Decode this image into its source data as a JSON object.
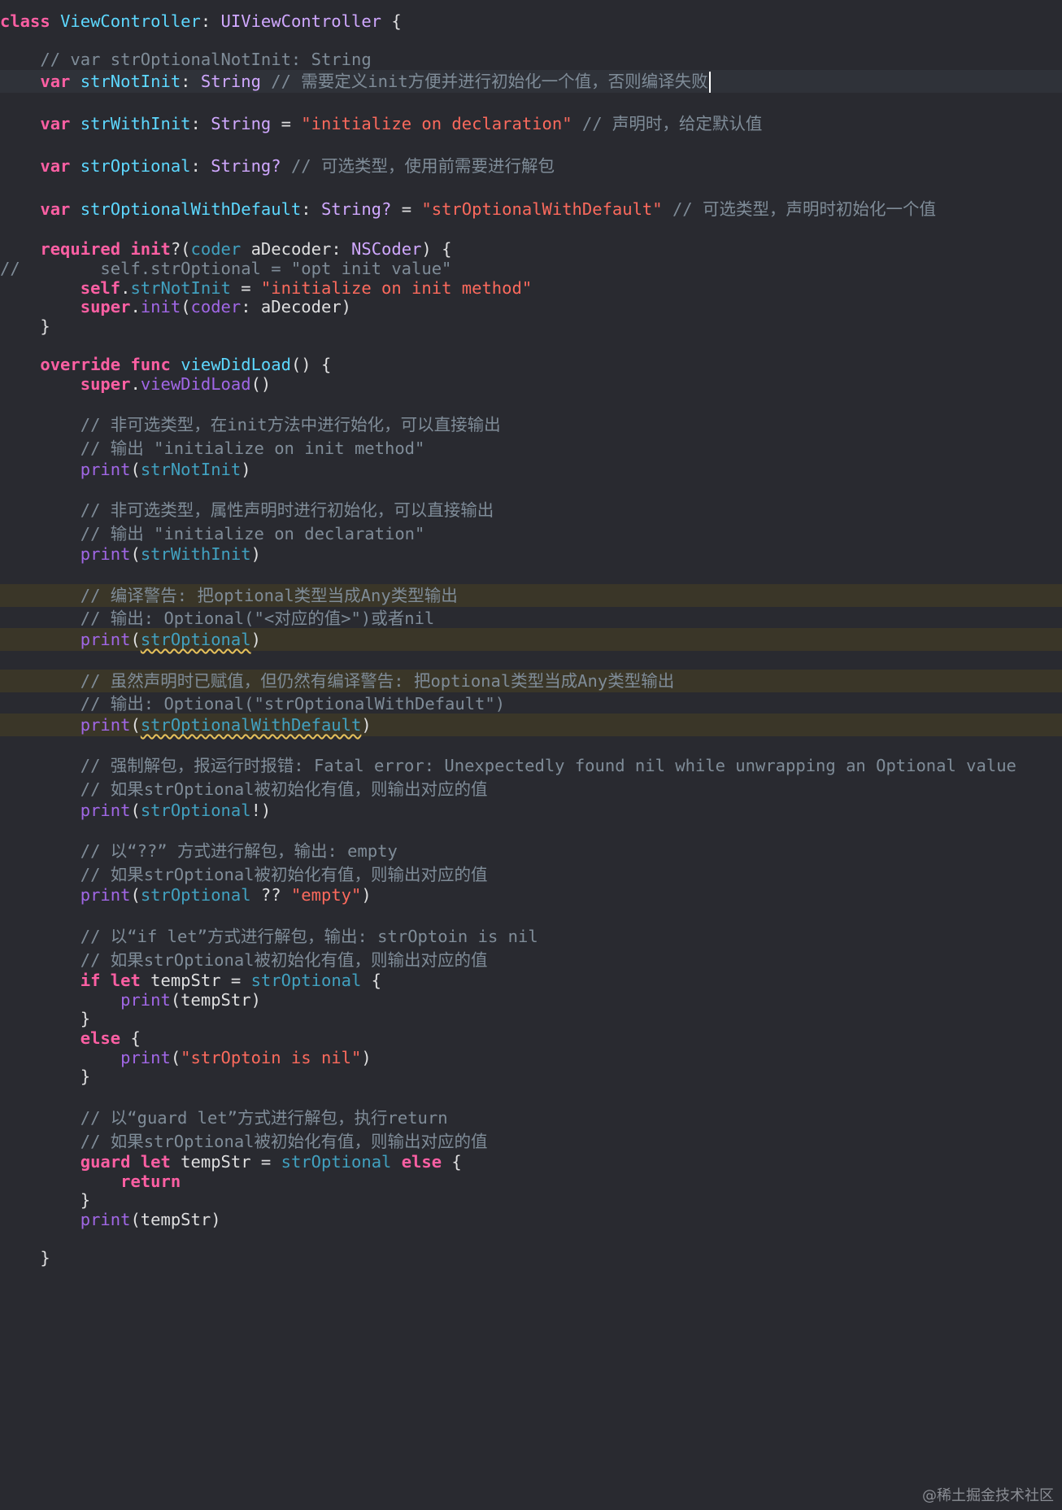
{
  "colors": {
    "background": "#292a30",
    "keyword": "#fc5fa3",
    "declaration": "#5dd8ff",
    "type": "#d0a8ff",
    "property": "#41a1c0",
    "function": "#a167e6",
    "string": "#fc6a5d",
    "comment": "#7f8c98",
    "plain": "#dfdfe0",
    "warning_underline": "#e5c05b"
  },
  "code_lines": [
    {
      "hl": "",
      "tokens": [
        {
          "t": "class",
          "c": "kw"
        },
        {
          "t": " ",
          "c": "txt"
        },
        {
          "t": "ViewController",
          "c": "cls"
        },
        {
          "t": ": ",
          "c": "txt"
        },
        {
          "t": "UIViewController",
          "c": "typ"
        },
        {
          "t": " {",
          "c": "txt"
        }
      ]
    },
    {
      "hl": "",
      "tokens": [
        {
          "t": "    // var strOptionalNotInit: String",
          "c": "cmt"
        }
      ]
    },
    {
      "hl": "current",
      "caret": true,
      "tokens": [
        {
          "t": "    ",
          "c": "txt"
        },
        {
          "t": "var",
          "c": "kw"
        },
        {
          "t": " ",
          "c": "txt"
        },
        {
          "t": "strNotInit",
          "c": "cls"
        },
        {
          "t": ": ",
          "c": "txt"
        },
        {
          "t": "String",
          "c": "typ"
        },
        {
          "t": " // 需要定义init方便并进行初始化一个值，否则编译失败",
          "c": "cmt"
        }
      ]
    },
    {
      "hl": "",
      "tokens": [
        {
          "t": "    ",
          "c": "txt"
        },
        {
          "t": "var",
          "c": "kw"
        },
        {
          "t": " ",
          "c": "txt"
        },
        {
          "t": "strWithInit",
          "c": "cls"
        },
        {
          "t": ": ",
          "c": "txt"
        },
        {
          "t": "String",
          "c": "typ"
        },
        {
          "t": " = ",
          "c": "txt"
        },
        {
          "t": "\"initialize on declaration\"",
          "c": "str"
        },
        {
          "t": " // 声明时，给定默认值",
          "c": "cmt"
        }
      ]
    },
    {
      "hl": "",
      "tokens": [
        {
          "t": "    ",
          "c": "txt"
        },
        {
          "t": "var",
          "c": "kw"
        },
        {
          "t": " ",
          "c": "txt"
        },
        {
          "t": "strOptional",
          "c": "cls"
        },
        {
          "t": ": ",
          "c": "txt"
        },
        {
          "t": "String?",
          "c": "typ"
        },
        {
          "t": " // 可选类型，使用前需要进行解包",
          "c": "cmt"
        }
      ]
    },
    {
      "hl": "",
      "tokens": [
        {
          "t": "    ",
          "c": "txt"
        },
        {
          "t": "var",
          "c": "kw"
        },
        {
          "t": " ",
          "c": "txt"
        },
        {
          "t": "strOptionalWithDefault",
          "c": "cls"
        },
        {
          "t": ": ",
          "c": "txt"
        },
        {
          "t": "String?",
          "c": "typ"
        },
        {
          "t": " = ",
          "c": "txt"
        },
        {
          "t": "\"strOptionalWithDefault\"",
          "c": "str"
        },
        {
          "t": " // 可选类型，声明时初始化一个值",
          "c": "cmt"
        }
      ]
    },
    {
      "hl": "",
      "tokens": [
        {
          "t": "    ",
          "c": "txt"
        },
        {
          "t": "required",
          "c": "kw"
        },
        {
          "t": " ",
          "c": "txt"
        },
        {
          "t": "init",
          "c": "kw"
        },
        {
          "t": "?(",
          "c": "txt"
        },
        {
          "t": "coder",
          "c": "prop"
        },
        {
          "t": " aDecoder: ",
          "c": "txt"
        },
        {
          "t": "NSCoder",
          "c": "typ"
        },
        {
          "t": ") {",
          "c": "txt"
        }
      ]
    },
    {
      "hl": "",
      "tokens": [
        {
          "t": "//        self.strOptional = \"opt init value\"",
          "c": "cmt"
        }
      ]
    },
    {
      "hl": "",
      "tokens": [
        {
          "t": "        ",
          "c": "txt"
        },
        {
          "t": "self",
          "c": "kw"
        },
        {
          "t": ".",
          "c": "txt"
        },
        {
          "t": "strNotInit",
          "c": "prop"
        },
        {
          "t": " = ",
          "c": "txt"
        },
        {
          "t": "\"initialize on init method\"",
          "c": "str"
        }
      ]
    },
    {
      "hl": "",
      "tokens": [
        {
          "t": "        ",
          "c": "txt"
        },
        {
          "t": "super",
          "c": "kw"
        },
        {
          "t": ".",
          "c": "txt"
        },
        {
          "t": "init",
          "c": "fn"
        },
        {
          "t": "(",
          "c": "txt"
        },
        {
          "t": "coder",
          "c": "fn"
        },
        {
          "t": ": aDecoder)",
          "c": "txt"
        }
      ]
    },
    {
      "hl": "",
      "tokens": [
        {
          "t": "    }",
          "c": "txt"
        }
      ]
    },
    {
      "hl": "",
      "tokens": [
        {
          "t": "    ",
          "c": "txt"
        },
        {
          "t": "override",
          "c": "kw"
        },
        {
          "t": " ",
          "c": "txt"
        },
        {
          "t": "func",
          "c": "kw"
        },
        {
          "t": " ",
          "c": "txt"
        },
        {
          "t": "viewDidLoad",
          "c": "cls"
        },
        {
          "t": "() {",
          "c": "txt"
        }
      ]
    },
    {
      "hl": "",
      "tokens": [
        {
          "t": "        ",
          "c": "txt"
        },
        {
          "t": "super",
          "c": "kw"
        },
        {
          "t": ".",
          "c": "txt"
        },
        {
          "t": "viewDidLoad",
          "c": "fn"
        },
        {
          "t": "()",
          "c": "txt"
        }
      ]
    },
    {
      "hl": "",
      "tokens": [
        {
          "t": "        // 非可选类型，在init方法中进行始化，可以直接输出",
          "c": "cmt"
        }
      ]
    },
    {
      "hl": "",
      "tokens": [
        {
          "t": "        // 输出 \"initialize on init method\"",
          "c": "cmt"
        }
      ]
    },
    {
      "hl": "",
      "tokens": [
        {
          "t": "        ",
          "c": "txt"
        },
        {
          "t": "print",
          "c": "fn"
        },
        {
          "t": "(",
          "c": "txt"
        },
        {
          "t": "strNotInit",
          "c": "prop"
        },
        {
          "t": ")",
          "c": "txt"
        }
      ]
    },
    {
      "hl": "",
      "tokens": [
        {
          "t": "        // 非可选类型，属性声明时进行初始化，可以直接输出",
          "c": "cmt"
        }
      ]
    },
    {
      "hl": "",
      "tokens": [
        {
          "t": "        // 输出 \"initialize on declaration\"",
          "c": "cmt"
        }
      ]
    },
    {
      "hl": "",
      "tokens": [
        {
          "t": "        ",
          "c": "txt"
        },
        {
          "t": "print",
          "c": "fn"
        },
        {
          "t": "(",
          "c": "txt"
        },
        {
          "t": "strWithInit",
          "c": "prop"
        },
        {
          "t": ")",
          "c": "txt"
        }
      ]
    },
    {
      "hl": "warn",
      "tokens": [
        {
          "t": "        // 编译警告: 把optional类型当成Any类型输出",
          "c": "cmt"
        }
      ]
    },
    {
      "hl": "",
      "tokens": [
        {
          "t": "        // 输出: Optional(\"<对应的值>\")或者nil",
          "c": "cmt"
        }
      ]
    },
    {
      "hl": "warn",
      "tokens": [
        {
          "t": "        ",
          "c": "txt"
        },
        {
          "t": "print",
          "c": "fn"
        },
        {
          "t": "(",
          "c": "txt"
        },
        {
          "t": "strOptional",
          "c": "prop"
        },
        {
          "t": ")",
          "c": "txt"
        }
      ]
    },
    {
      "hl": "warn",
      "tokens": [
        {
          "t": "        // 虽然声明时已赋值，但仍然有编译警告: 把optional类型当成Any类型输出",
          "c": "cmt"
        }
      ]
    },
    {
      "hl": "",
      "tokens": [
        {
          "t": "        // 输出: Optional(\"strOptionalWithDefault\")",
          "c": "cmt"
        }
      ]
    },
    {
      "hl": "warn",
      "tokens": [
        {
          "t": "        ",
          "c": "txt"
        },
        {
          "t": "print",
          "c": "fn"
        },
        {
          "t": "(",
          "c": "txt"
        },
        {
          "t": "strOptionalWithDefault",
          "c": "prop"
        },
        {
          "t": ")",
          "c": "txt"
        }
      ]
    },
    {
      "hl": "",
      "tokens": [
        {
          "t": "        // 强制解包，报运行时报错: Fatal error: Unexpectedly found nil while unwrapping an Optional value",
          "c": "cmt"
        }
      ]
    },
    {
      "hl": "",
      "tokens": [
        {
          "t": "        // 如果strOptional被初始化有值，则输出对应的值",
          "c": "cmt"
        }
      ]
    },
    {
      "hl": "",
      "tokens": [
        {
          "t": "        ",
          "c": "txt"
        },
        {
          "t": "print",
          "c": "fn"
        },
        {
          "t": "(",
          "c": "txt"
        },
        {
          "t": "strOptional",
          "c": "prop"
        },
        {
          "t": "!)",
          "c": "txt"
        }
      ]
    },
    {
      "hl": "",
      "tokens": [
        {
          "t": "        // 以“??” 方式进行解包，输出: empty",
          "c": "cmt"
        }
      ]
    },
    {
      "hl": "",
      "tokens": [
        {
          "t": "        // 如果strOptional被初始化有值，则输出对应的值",
          "c": "cmt"
        }
      ]
    },
    {
      "hl": "",
      "tokens": [
        {
          "t": "        ",
          "c": "txt"
        },
        {
          "t": "print",
          "c": "fn"
        },
        {
          "t": "(",
          "c": "txt"
        },
        {
          "t": "strOptional",
          "c": "prop"
        },
        {
          "t": " ?? ",
          "c": "txt"
        },
        {
          "t": "\"empty\"",
          "c": "str"
        },
        {
          "t": ")",
          "c": "txt"
        }
      ]
    },
    {
      "hl": "",
      "tokens": [
        {
          "t": "        // 以“if let”方式进行解包，输出: strOptoin is nil",
          "c": "cmt"
        }
      ]
    },
    {
      "hl": "",
      "tokens": [
        {
          "t": "        // 如果strOptional被初始化有值，则输出对应的值",
          "c": "cmt"
        }
      ]
    },
    {
      "hl": "",
      "tokens": [
        {
          "t": "        ",
          "c": "txt"
        },
        {
          "t": "if",
          "c": "kw"
        },
        {
          "t": " ",
          "c": "txt"
        },
        {
          "t": "let",
          "c": "kw"
        },
        {
          "t": " tempStr = ",
          "c": "txt"
        },
        {
          "t": "strOptional",
          "c": "prop"
        },
        {
          "t": " {",
          "c": "txt"
        }
      ]
    },
    {
      "hl": "",
      "tokens": [
        {
          "t": "            ",
          "c": "txt"
        },
        {
          "t": "print",
          "c": "fn"
        },
        {
          "t": "(tempStr)",
          "c": "txt"
        }
      ]
    },
    {
      "hl": "",
      "tokens": [
        {
          "t": "        }",
          "c": "txt"
        }
      ]
    },
    {
      "hl": "",
      "tokens": [
        {
          "t": "        ",
          "c": "txt"
        },
        {
          "t": "else",
          "c": "kw"
        },
        {
          "t": " {",
          "c": "txt"
        }
      ]
    },
    {
      "hl": "",
      "tokens": [
        {
          "t": "            ",
          "c": "txt"
        },
        {
          "t": "print",
          "c": "fn"
        },
        {
          "t": "(",
          "c": "txt"
        },
        {
          "t": "\"strOptoin is nil\"",
          "c": "str"
        },
        {
          "t": ")",
          "c": "txt"
        }
      ]
    },
    {
      "hl": "",
      "tokens": [
        {
          "t": "        }",
          "c": "txt"
        }
      ]
    },
    {
      "hl": "",
      "tokens": [
        {
          "t": "        // 以“guard let”方式进行解包，执行return",
          "c": "cmt"
        }
      ]
    },
    {
      "hl": "",
      "tokens": [
        {
          "t": "        // 如果strOptional被初始化有值，则输出对应的值",
          "c": "cmt"
        }
      ]
    },
    {
      "hl": "",
      "tokens": [
        {
          "t": "        ",
          "c": "txt"
        },
        {
          "t": "guard",
          "c": "kw"
        },
        {
          "t": " ",
          "c": "txt"
        },
        {
          "t": "let",
          "c": "kw"
        },
        {
          "t": " tempStr = ",
          "c": "txt"
        },
        {
          "t": "strOptional",
          "c": "prop"
        },
        {
          "t": " ",
          "c": "txt"
        },
        {
          "t": "else",
          "c": "kw"
        },
        {
          "t": " {",
          "c": "txt"
        }
      ]
    },
    {
      "hl": "",
      "tokens": [
        {
          "t": "            ",
          "c": "txt"
        },
        {
          "t": "return",
          "c": "kw"
        }
      ]
    },
    {
      "hl": "",
      "tokens": [
        {
          "t": "        }",
          "c": "txt"
        }
      ]
    },
    {
      "hl": "",
      "tokens": [
        {
          "t": "        ",
          "c": "txt"
        },
        {
          "t": "print",
          "c": "fn"
        },
        {
          "t": "(tempStr)",
          "c": "txt"
        }
      ]
    },
    {
      "hl": "",
      "tokens": [
        {
          "t": "    }",
          "c": "txt"
        }
      ]
    }
  ],
  "watermark": "@稀土掘金技术社区"
}
